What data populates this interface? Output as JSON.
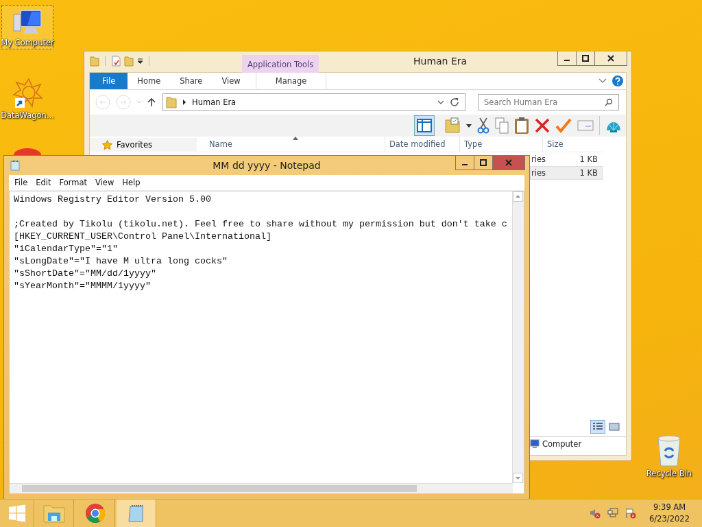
{
  "desktop_icons": [
    {
      "label": "My Computer",
      "kind": "computer",
      "selected": true
    },
    {
      "label": "DataWagon...",
      "kind": "shortcut",
      "selected": false
    },
    {
      "label": "Recycle Bin",
      "kind": "recycle",
      "selected": false
    }
  ],
  "explorer": {
    "title": "Human Era",
    "context_tab": "Application Tools",
    "tabs": [
      {
        "label": "File",
        "kind": "file",
        "selected": false
      },
      {
        "label": "Home",
        "kind": "tab",
        "selected": false
      },
      {
        "label": "Share",
        "kind": "tab",
        "selected": false
      },
      {
        "label": "View",
        "kind": "tab",
        "selected": false
      },
      {
        "label": "Manage",
        "kind": "context",
        "selected": false
      }
    ],
    "address": "Human Era",
    "search": {
      "placeholder": "Search Human Era"
    },
    "columns": [
      "Name",
      "Date modified",
      "Type",
      "Size"
    ],
    "favorites": "Favorites",
    "rows": [
      {
        "type": "ries",
        "size": "1 KB",
        "selected": false
      },
      {
        "type": "ries",
        "size": "1 KB",
        "selected": true
      }
    ],
    "footer_item": "Computer"
  },
  "notepad": {
    "title": "MM dd yyyy - Notepad",
    "menu": [
      "File",
      "Edit",
      "Format",
      "View",
      "Help"
    ],
    "text": "Windows Registry Editor Version 5.00\n\n;Created by Tikolu (tikolu.net). Feel free to share without my permission but don't take c\n[HKEY_CURRENT_USER\\Control Panel\\International]\n\"iCalendarType\"=\"1\"\n\"sLongDate\"=\"I have M ultra long cocks\"\n\"sShortDate\"=\"MM/dd/1yyyy\"\n\"sYearMonth\"=\"MMMM/1yyyy\""
  },
  "taskbar": {
    "apps": [
      {
        "kind": "explorer",
        "selected": false
      },
      {
        "kind": "chrome",
        "selected": false
      },
      {
        "kind": "notepad",
        "selected": true
      }
    ],
    "clock": {
      "time": "9:39 AM",
      "date": "6/23/2022"
    }
  }
}
